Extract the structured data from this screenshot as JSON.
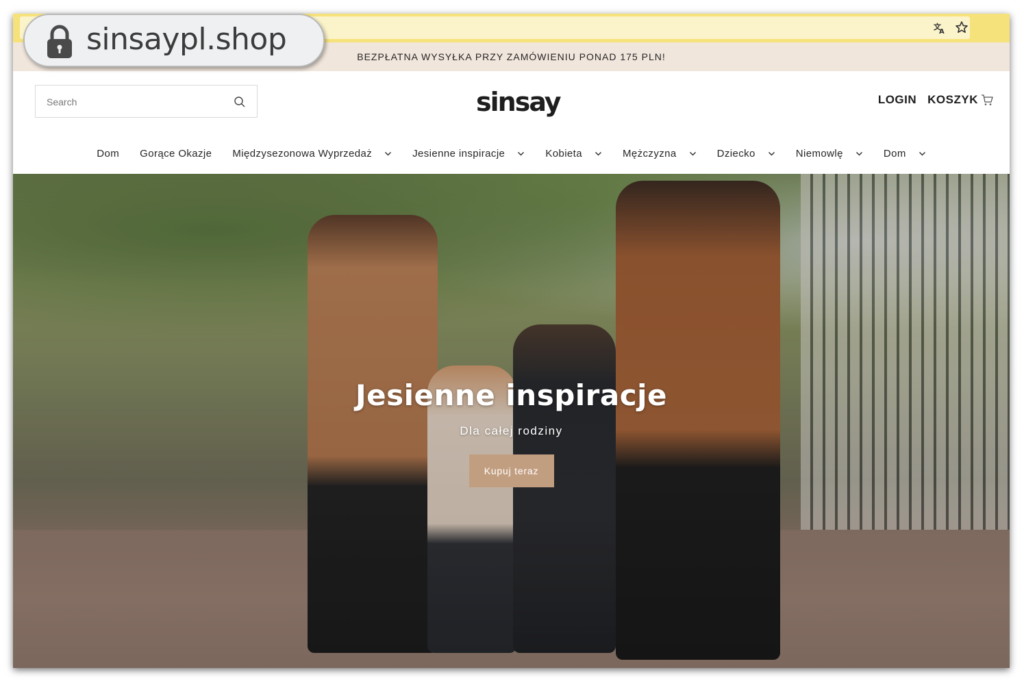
{
  "browser": {
    "domain": "sinsaypl.shop",
    "icons": [
      "lock-icon",
      "translate-icon",
      "star-icon"
    ]
  },
  "announcement": "BEZPŁATNA WYSYŁKA PRZY ZAMÓWIENIU PONAD 175 PLN!",
  "header": {
    "search_placeholder": "Search",
    "logo": "sinsay",
    "login": "LOGIN",
    "cart": "KOSZYK"
  },
  "nav": {
    "items": [
      {
        "label": "Dom"
      },
      {
        "label": "Gorące Okazje"
      },
      {
        "label": "Międzysezonowa Wyprzedaż"
      },
      {
        "label": "Jesienne inspiracje"
      },
      {
        "label": "Kobieta"
      },
      {
        "label": "Mężczyzna"
      },
      {
        "label": "Dziecko"
      },
      {
        "label": "Niemowlę"
      },
      {
        "label": "Dom"
      }
    ]
  },
  "hero": {
    "title": "Jesienne inspiracje",
    "subtitle": "Dla całej rodziny",
    "button": "Kupuj teraz"
  },
  "colors": {
    "announcement_bg": "#f1e6dc",
    "button_bg": "#c29e80",
    "url_bar": "#f6e27a"
  }
}
